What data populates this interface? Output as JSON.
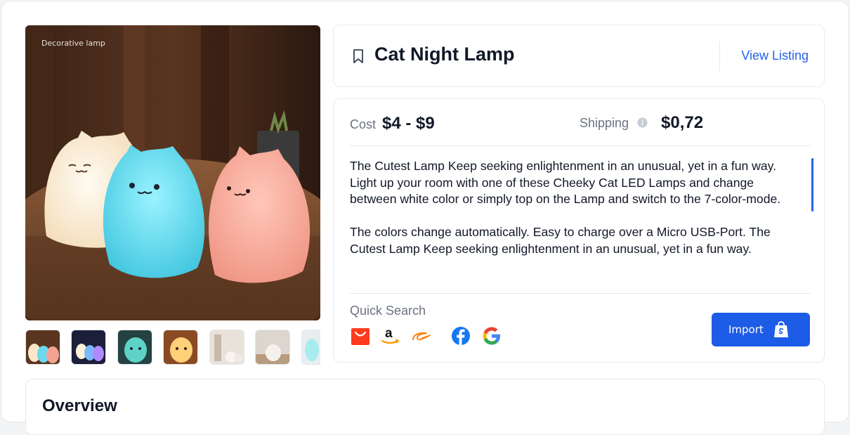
{
  "image": {
    "caption": "Decorative lamp",
    "thumbnails": [
      "thumb-1",
      "thumb-2",
      "thumb-3",
      "thumb-4",
      "thumb-5",
      "thumb-6",
      "thumb-7"
    ]
  },
  "product": {
    "title": "Cat Night Lamp",
    "view_listing_label": "View Listing"
  },
  "pricing": {
    "cost_label": "Cost",
    "cost_value": "$4 - $9",
    "shipping_label": "Shipping",
    "shipping_value": "$0,72"
  },
  "description": {
    "paragraphs": [
      "The Cutest Lamp Keep seeking enlightenment in an unusual, yet in a fun way. Light up your room with one of these Cheeky Cat LED Lamps and change between white color or simply top on the Lamp and switch to the 7-color-mode.",
      "The colors change automatically. Easy to charge over a Micro USB-Port. The Cutest Lamp Keep seeking enlightenment in an unusual, yet in a fun way."
    ]
  },
  "quick_search": {
    "label": "Quick Search",
    "sources": [
      "aliexpress-icon",
      "amazon-icon",
      "alibaba-icon",
      "facebook-icon",
      "google-icon"
    ]
  },
  "actions": {
    "import_label": "Import"
  },
  "overview": {
    "title": "Overview"
  },
  "colors": {
    "accent": "#2563eb",
    "import_button": "#1d5ce6",
    "muted_text": "#6b7280",
    "heading": "#111827"
  }
}
